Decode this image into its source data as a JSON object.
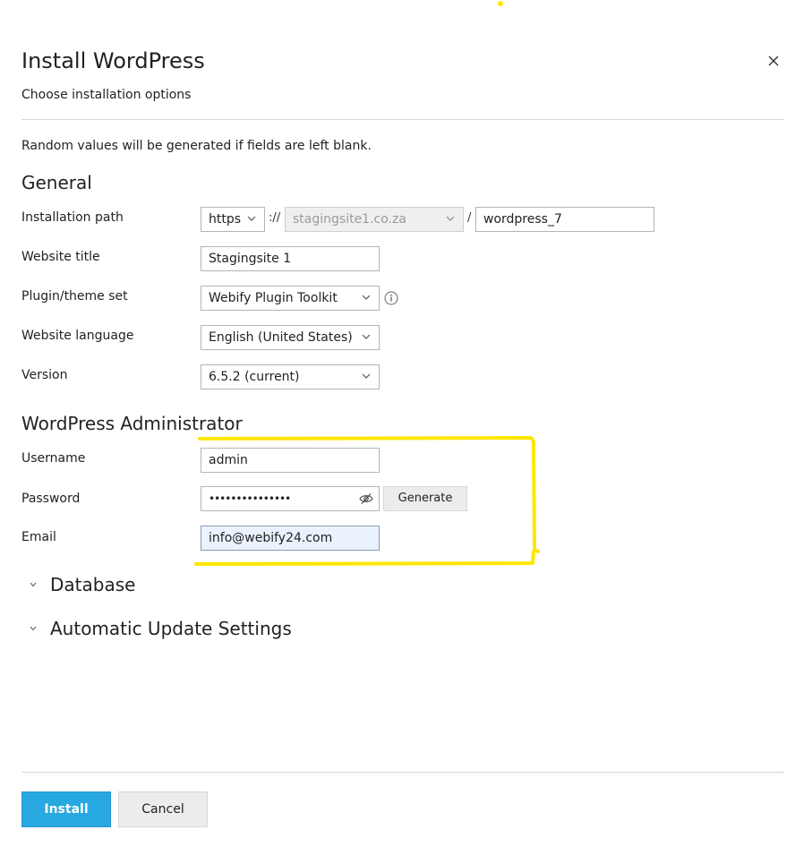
{
  "dialog": {
    "title": "Install WordPress",
    "subtitle": "Choose installation options"
  },
  "hint": "Random values will be generated if fields are left blank.",
  "general": {
    "heading": "General",
    "installation_path": {
      "label": "Installation path",
      "protocol": "https",
      "separator": "://",
      "domain": "stagingsite1.co.za",
      "slash": "/",
      "directory": "wordpress_7"
    },
    "website_title": {
      "label": "Website title",
      "value": "Stagingsite 1"
    },
    "plugin_theme_set": {
      "label": "Plugin/theme set",
      "value": "Webify Plugin Toolkit"
    },
    "website_language": {
      "label": "Website language",
      "value": "English (United States)"
    },
    "version": {
      "label": "Version",
      "value": "6.5.2 (current)"
    }
  },
  "admin": {
    "heading": "WordPress Administrator",
    "username": {
      "label": "Username",
      "value": "admin"
    },
    "password": {
      "label": "Password",
      "value": "•••••••••••••••",
      "generate_label": "Generate"
    },
    "email": {
      "label": "Email",
      "value": "info@webify24.com"
    }
  },
  "sections": {
    "database": "Database",
    "auto_update": "Automatic Update Settings"
  },
  "footer": {
    "install_label": "Install",
    "cancel_label": "Cancel"
  },
  "colors": {
    "primary": "#28a8e0",
    "annotation": "#ffe600"
  }
}
